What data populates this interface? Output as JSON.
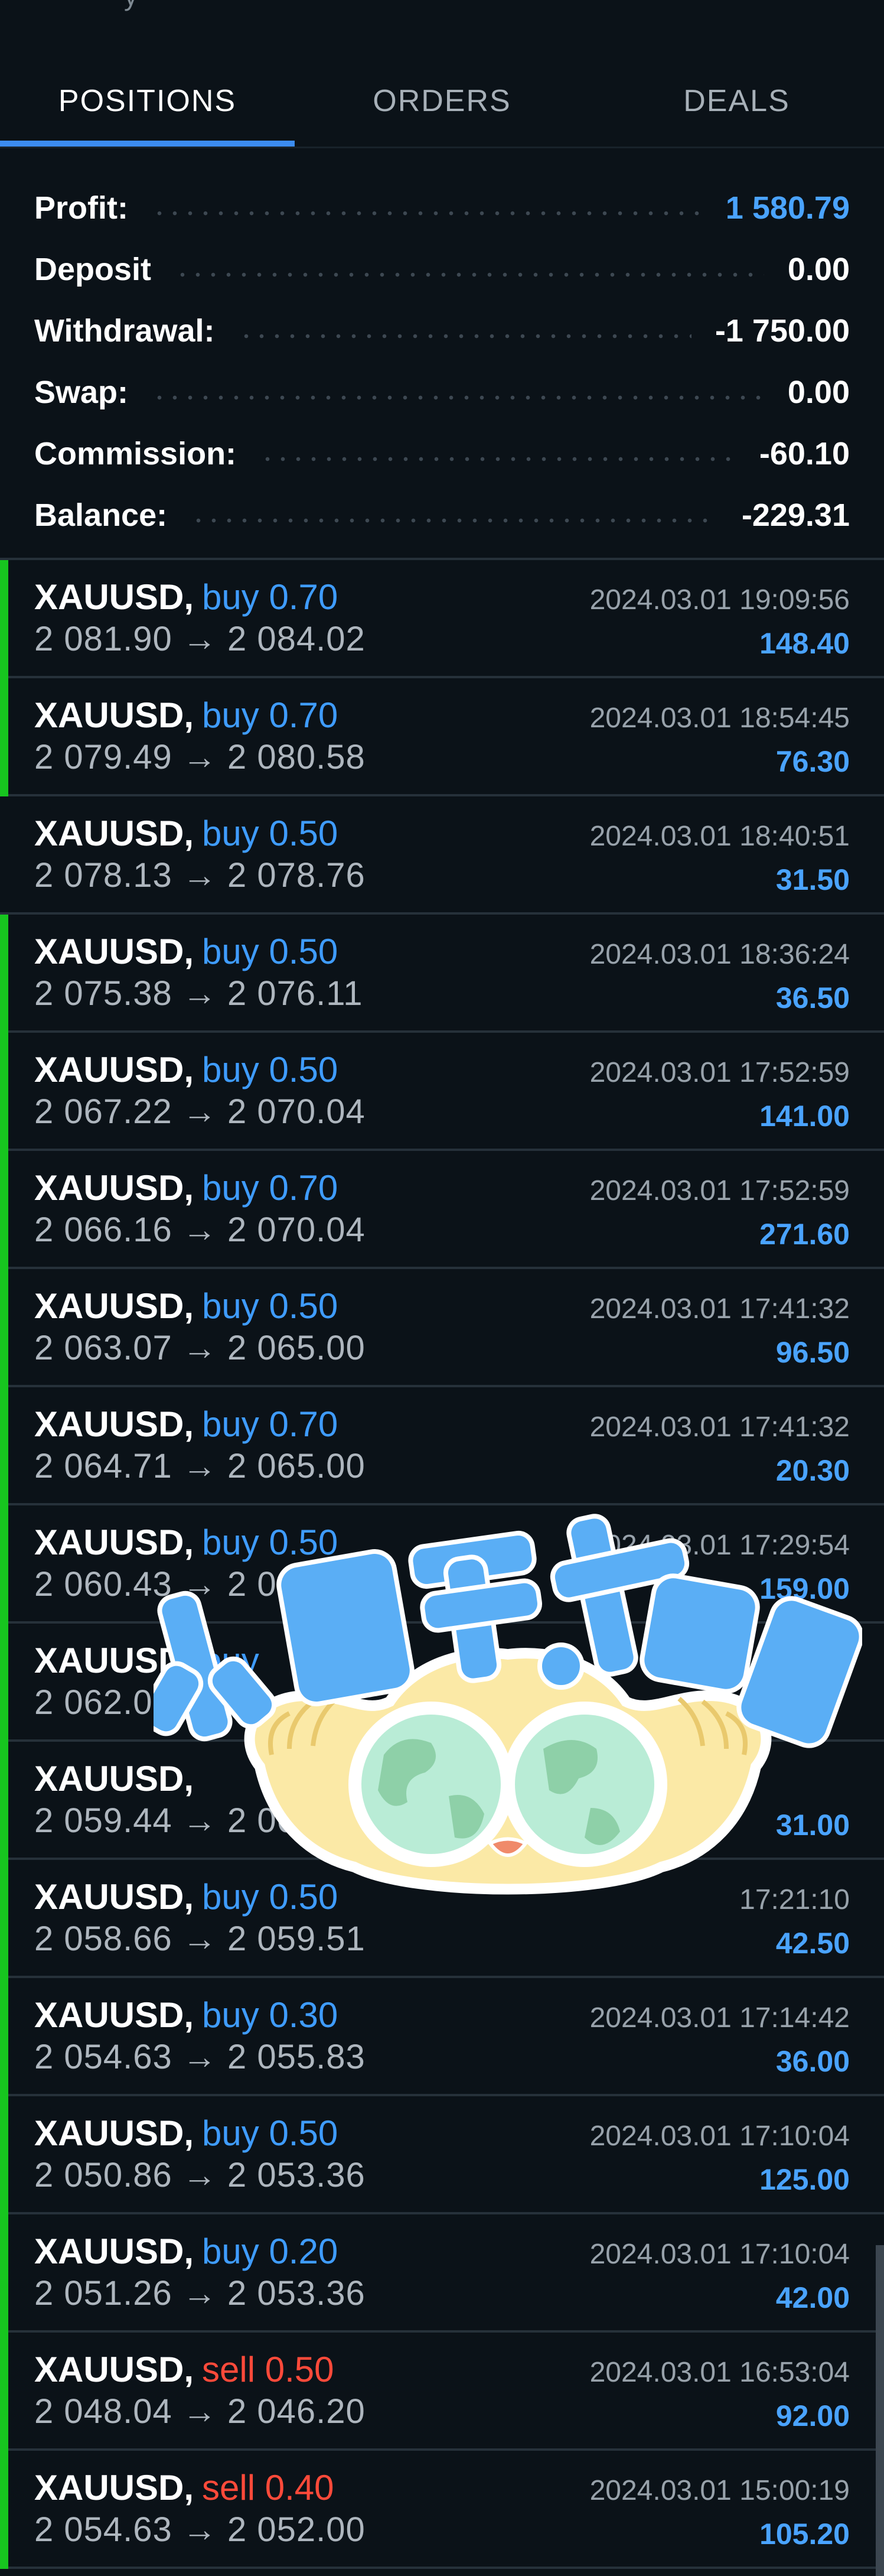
{
  "tabs": {
    "positions": "POSITIONS",
    "orders": "ORDERS",
    "deals": "DEALS",
    "active": "positions"
  },
  "summary": {
    "profit_label": "Profit:",
    "profit_value": "1 580.79",
    "deposit_label": "Deposit",
    "deposit_value": "0.00",
    "withdrawal_label": "Withdrawal:",
    "withdrawal_value": "-1 750.00",
    "swap_label": "Swap:",
    "swap_value": "0.00",
    "commission_label": "Commission:",
    "commission_value": "-60.10",
    "balance_label": "Balance:",
    "balance_value": "-229.31"
  },
  "positions": [
    {
      "symbol": "XAUUSD,",
      "side": "buy 0.70",
      "prices": "2 081.90 → 2 084.02",
      "time": "2024.03.01 19:09:56",
      "profit": "148.40",
      "bar": true
    },
    {
      "symbol": "XAUUSD,",
      "side": "buy 0.70",
      "prices": "2 079.49 → 2 080.58",
      "time": "2024.03.01 18:54:45",
      "profit": "76.30",
      "bar": true
    },
    {
      "symbol": "XAUUSD,",
      "side": "buy 0.50",
      "prices": "2 078.13 → 2 078.76",
      "time": "2024.03.01 18:40:51",
      "profit": "31.50",
      "bar": false
    },
    {
      "symbol": "XAUUSD,",
      "side": "buy 0.50",
      "prices": "2 075.38 → 2 076.11",
      "time": "2024.03.01 18:36:24",
      "profit": "36.50",
      "bar": true
    },
    {
      "symbol": "XAUUSD,",
      "side": "buy 0.50",
      "prices": "2 067.22 → 2 070.04",
      "time": "2024.03.01 17:52:59",
      "profit": "141.00",
      "bar": true
    },
    {
      "symbol": "XAUUSD,",
      "side": "buy 0.70",
      "prices": "2 066.16 → 2 070.04",
      "time": "2024.03.01 17:52:59",
      "profit": "271.60",
      "bar": true
    },
    {
      "symbol": "XAUUSD,",
      "side": "buy 0.50",
      "prices": "2 063.07 → 2 065.00",
      "time": "2024.03.01 17:41:32",
      "profit": "96.50",
      "bar": true
    },
    {
      "symbol": "XAUUSD,",
      "side": "buy 0.70",
      "prices": "2 064.71 → 2 065.00",
      "time": "2024.03.01 17:41:32",
      "profit": "20.30",
      "bar": true
    },
    {
      "symbol": "XAUUSD,",
      "side": "buy 0.50",
      "prices": "2 060.43 → 2 063",
      "time": "2024.03.01 17:29:54",
      "profit": "159.00",
      "bar": true
    },
    {
      "symbol": "XAUUSD,",
      "side": "buy",
      "prices": "2 062.09",
      "time": "",
      "profit": "",
      "bar": true
    },
    {
      "symbol": "XAUUSD,",
      "side": "",
      "prices": "2 059.44 → 2 06",
      "time": "",
      "profit": "31.00",
      "bar": true
    },
    {
      "symbol": "XAUUSD,",
      "side": "buy 0.50",
      "prices": "2 058.66 → 2 059.51",
      "time": "17:21:10",
      "profit": "42.50",
      "bar": true
    },
    {
      "symbol": "XAUUSD,",
      "side": "buy 0.30",
      "prices": "2 054.63 → 2 055.83",
      "time": "2024.03.01 17:14:42",
      "profit": "36.00",
      "bar": true
    },
    {
      "symbol": "XAUUSD,",
      "side": "buy 0.50",
      "prices": "2 050.86 → 2 053.36",
      "time": "2024.03.01 17:10:04",
      "profit": "125.00",
      "bar": true
    },
    {
      "symbol": "XAUUSD,",
      "side": "buy 0.20",
      "prices": "2 051.26 → 2 053.36",
      "time": "2024.03.01 17:10:04",
      "profit": "42.00",
      "bar": true
    },
    {
      "symbol": "XAUUSD,",
      "side": "sell 0.50",
      "prices": "2 048.04 → 2 046.20",
      "time": "2024.03.01 16:53:04",
      "profit": "92.00",
      "bar": true,
      "sell": true
    },
    {
      "symbol": "XAUUSD,",
      "side": "sell 0.40",
      "prices": "2 054.63 → 2 052.00",
      "time": "2024.03.01 15:00:19",
      "profit": "105.20",
      "bar": true,
      "sell": true
    }
  ],
  "sticker_text": "小日子,大成就",
  "colors": {
    "background": "#0b1218",
    "accent_blue": "#3c8cf0",
    "profit_blue": "#4aa3ff",
    "buy_blue": "#3f9cff",
    "sell_red": "#ff4a3a",
    "indicator_green": "#17c51f"
  }
}
